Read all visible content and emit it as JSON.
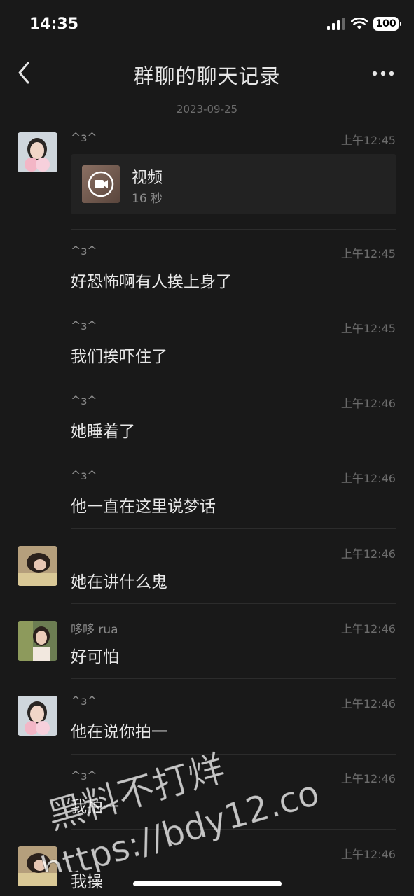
{
  "status_bar": {
    "time": "14:35",
    "battery": "100"
  },
  "header": {
    "title": "群聊的聊天记录"
  },
  "date_label": "2023-09-25",
  "video": {
    "title": "视频",
    "duration": "16 秒"
  },
  "messages": [
    {
      "sender": "^з^",
      "time": "上午12:45",
      "text": ""
    },
    {
      "sender": "^з^",
      "time": "上午12:45",
      "text": "好恐怖啊有人挨上身了"
    },
    {
      "sender": "^з^",
      "time": "上午12:45",
      "text": "我们挨吓住了"
    },
    {
      "sender": "^з^",
      "time": "上午12:46",
      "text": "她睡着了"
    },
    {
      "sender": "^з^",
      "time": "上午12:46",
      "text": "他一直在这里说梦话"
    },
    {
      "sender": "",
      "time": "上午12:46",
      "text": "她在讲什么鬼"
    },
    {
      "sender": "哆哆 rua",
      "time": "上午12:46",
      "text": "好可怕"
    },
    {
      "sender": "^з^",
      "time": "上午12:46",
      "text": "他在说你拍一"
    },
    {
      "sender": "^з^",
      "time": "上午12:46",
      "text": "我拍一"
    },
    {
      "sender": "",
      "time": "上午12:46",
      "text": "我操"
    }
  ],
  "watermark": {
    "line1": "黑料不打烊",
    "line2": "https://bdy12.co"
  },
  "colors": {
    "background": "#191919",
    "text": "#e8e8e8",
    "secondary": "#8a8a8a",
    "muted": "#6c6c6c"
  }
}
